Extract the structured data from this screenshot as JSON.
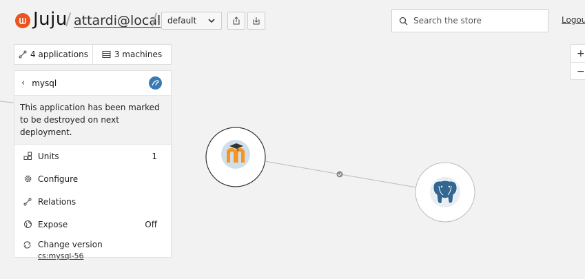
{
  "header": {
    "logo_text": "Juju",
    "user": "attardi@local",
    "model": "default",
    "search_placeholder": "Search the store",
    "logout": "Logout"
  },
  "tabs": {
    "applications": "4 applications",
    "machines": "3 machines"
  },
  "inspector": {
    "title": "mysql",
    "notice": "This application has been marked to be destroyed on next deployment.",
    "items": [
      {
        "label": "Units",
        "value": "1",
        "icon": "units-icon"
      },
      {
        "label": "Configure",
        "value": "",
        "icon": "gear-icon"
      },
      {
        "label": "Relations",
        "value": "",
        "icon": "relations-icon"
      },
      {
        "label": "Expose",
        "value": "Off",
        "icon": "expose-icon"
      }
    ],
    "change_version": {
      "label": "Change version",
      "charm": "cs:mysql-56"
    }
  },
  "zoom": {
    "in": "+",
    "out": "−"
  },
  "canvas": {
    "nodes": [
      {
        "name": "moodle",
        "icon": "moodle-icon"
      },
      {
        "name": "postgresql",
        "icon": "postgresql-icon"
      }
    ]
  },
  "colors": {
    "brand": "#e95420",
    "canvas_bg": "#f2f2f2",
    "mysql_icon": "#3a7ab4",
    "moodle_orange": "#f7931e",
    "postgres_blue": "#336791"
  }
}
